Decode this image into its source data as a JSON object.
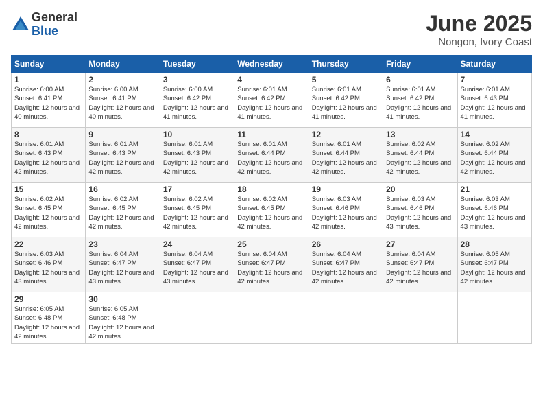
{
  "logo": {
    "general": "General",
    "blue": "Blue"
  },
  "title": "June 2025",
  "location": "Nongon, Ivory Coast",
  "days_header": [
    "Sunday",
    "Monday",
    "Tuesday",
    "Wednesday",
    "Thursday",
    "Friday",
    "Saturday"
  ],
  "weeks": [
    [
      {
        "day": "1",
        "sunrise": "Sunrise: 6:00 AM",
        "sunset": "Sunset: 6:41 PM",
        "daylight": "Daylight: 12 hours and 40 minutes."
      },
      {
        "day": "2",
        "sunrise": "Sunrise: 6:00 AM",
        "sunset": "Sunset: 6:41 PM",
        "daylight": "Daylight: 12 hours and 40 minutes."
      },
      {
        "day": "3",
        "sunrise": "Sunrise: 6:00 AM",
        "sunset": "Sunset: 6:42 PM",
        "daylight": "Daylight: 12 hours and 41 minutes."
      },
      {
        "day": "4",
        "sunrise": "Sunrise: 6:01 AM",
        "sunset": "Sunset: 6:42 PM",
        "daylight": "Daylight: 12 hours and 41 minutes."
      },
      {
        "day": "5",
        "sunrise": "Sunrise: 6:01 AM",
        "sunset": "Sunset: 6:42 PM",
        "daylight": "Daylight: 12 hours and 41 minutes."
      },
      {
        "day": "6",
        "sunrise": "Sunrise: 6:01 AM",
        "sunset": "Sunset: 6:42 PM",
        "daylight": "Daylight: 12 hours and 41 minutes."
      },
      {
        "day": "7",
        "sunrise": "Sunrise: 6:01 AM",
        "sunset": "Sunset: 6:43 PM",
        "daylight": "Daylight: 12 hours and 41 minutes."
      }
    ],
    [
      {
        "day": "8",
        "sunrise": "Sunrise: 6:01 AM",
        "sunset": "Sunset: 6:43 PM",
        "daylight": "Daylight: 12 hours and 42 minutes."
      },
      {
        "day": "9",
        "sunrise": "Sunrise: 6:01 AM",
        "sunset": "Sunset: 6:43 PM",
        "daylight": "Daylight: 12 hours and 42 minutes."
      },
      {
        "day": "10",
        "sunrise": "Sunrise: 6:01 AM",
        "sunset": "Sunset: 6:43 PM",
        "daylight": "Daylight: 12 hours and 42 minutes."
      },
      {
        "day": "11",
        "sunrise": "Sunrise: 6:01 AM",
        "sunset": "Sunset: 6:44 PM",
        "daylight": "Daylight: 12 hours and 42 minutes."
      },
      {
        "day": "12",
        "sunrise": "Sunrise: 6:01 AM",
        "sunset": "Sunset: 6:44 PM",
        "daylight": "Daylight: 12 hours and 42 minutes."
      },
      {
        "day": "13",
        "sunrise": "Sunrise: 6:02 AM",
        "sunset": "Sunset: 6:44 PM",
        "daylight": "Daylight: 12 hours and 42 minutes."
      },
      {
        "day": "14",
        "sunrise": "Sunrise: 6:02 AM",
        "sunset": "Sunset: 6:44 PM",
        "daylight": "Daylight: 12 hours and 42 minutes."
      }
    ],
    [
      {
        "day": "15",
        "sunrise": "Sunrise: 6:02 AM",
        "sunset": "Sunset: 6:45 PM",
        "daylight": "Daylight: 12 hours and 42 minutes."
      },
      {
        "day": "16",
        "sunrise": "Sunrise: 6:02 AM",
        "sunset": "Sunset: 6:45 PM",
        "daylight": "Daylight: 12 hours and 42 minutes."
      },
      {
        "day": "17",
        "sunrise": "Sunrise: 6:02 AM",
        "sunset": "Sunset: 6:45 PM",
        "daylight": "Daylight: 12 hours and 42 minutes."
      },
      {
        "day": "18",
        "sunrise": "Sunrise: 6:02 AM",
        "sunset": "Sunset: 6:45 PM",
        "daylight": "Daylight: 12 hours and 42 minutes."
      },
      {
        "day": "19",
        "sunrise": "Sunrise: 6:03 AM",
        "sunset": "Sunset: 6:46 PM",
        "daylight": "Daylight: 12 hours and 42 minutes."
      },
      {
        "day": "20",
        "sunrise": "Sunrise: 6:03 AM",
        "sunset": "Sunset: 6:46 PM",
        "daylight": "Daylight: 12 hours and 43 minutes."
      },
      {
        "day": "21",
        "sunrise": "Sunrise: 6:03 AM",
        "sunset": "Sunset: 6:46 PM",
        "daylight": "Daylight: 12 hours and 43 minutes."
      }
    ],
    [
      {
        "day": "22",
        "sunrise": "Sunrise: 6:03 AM",
        "sunset": "Sunset: 6:46 PM",
        "daylight": "Daylight: 12 hours and 43 minutes."
      },
      {
        "day": "23",
        "sunrise": "Sunrise: 6:04 AM",
        "sunset": "Sunset: 6:47 PM",
        "daylight": "Daylight: 12 hours and 43 minutes."
      },
      {
        "day": "24",
        "sunrise": "Sunrise: 6:04 AM",
        "sunset": "Sunset: 6:47 PM",
        "daylight": "Daylight: 12 hours and 43 minutes."
      },
      {
        "day": "25",
        "sunrise": "Sunrise: 6:04 AM",
        "sunset": "Sunset: 6:47 PM",
        "daylight": "Daylight: 12 hours and 42 minutes."
      },
      {
        "day": "26",
        "sunrise": "Sunrise: 6:04 AM",
        "sunset": "Sunset: 6:47 PM",
        "daylight": "Daylight: 12 hours and 42 minutes."
      },
      {
        "day": "27",
        "sunrise": "Sunrise: 6:04 AM",
        "sunset": "Sunset: 6:47 PM",
        "daylight": "Daylight: 12 hours and 42 minutes."
      },
      {
        "day": "28",
        "sunrise": "Sunrise: 6:05 AM",
        "sunset": "Sunset: 6:47 PM",
        "daylight": "Daylight: 12 hours and 42 minutes."
      }
    ],
    [
      {
        "day": "29",
        "sunrise": "Sunrise: 6:05 AM",
        "sunset": "Sunset: 6:48 PM",
        "daylight": "Daylight: 12 hours and 42 minutes."
      },
      {
        "day": "30",
        "sunrise": "Sunrise: 6:05 AM",
        "sunset": "Sunset: 6:48 PM",
        "daylight": "Daylight: 12 hours and 42 minutes."
      },
      null,
      null,
      null,
      null,
      null
    ]
  ]
}
